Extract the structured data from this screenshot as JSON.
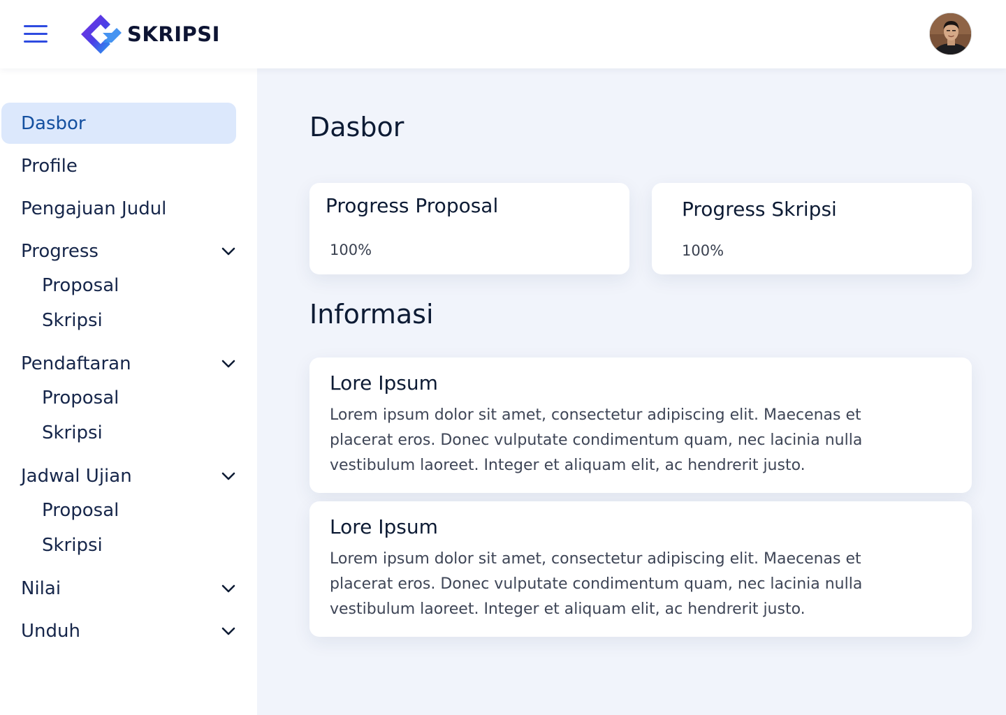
{
  "header": {
    "logo_text": "SKRIPSI",
    "menu_icon": "hamburger-menu-icon",
    "avatar_icon": "user-avatar"
  },
  "sidebar": {
    "items": [
      {
        "label": "Dasbor",
        "active": true
      },
      {
        "label": "Profile"
      },
      {
        "label": "Pengajuan Judul"
      },
      {
        "label": "Progress",
        "expandable": true,
        "children": [
          "Proposal",
          "Skripsi"
        ]
      },
      {
        "label": "Pendaftaran",
        "expandable": true,
        "children": [
          "Proposal",
          "Skripsi"
        ]
      },
      {
        "label": "Jadwal Ujian",
        "expandable": true,
        "children": [
          "Proposal",
          "Skripsi"
        ]
      },
      {
        "label": "Nilai",
        "expandable": true
      },
      {
        "label": "Unduh",
        "expandable": true
      }
    ]
  },
  "main": {
    "title": "Dasbor",
    "stats": [
      {
        "label": "Progress Proposal",
        "value": "100%"
      },
      {
        "label": "Progress Skripsi",
        "value": "100%"
      }
    ],
    "info_title": "Informasi",
    "info_cards": [
      {
        "title": "Lore Ipsum",
        "lines": [
          "Lorem ipsum dolor sit amet, consectetur adipiscing elit. Maecenas et",
          "placerat eros. Donec vulputate condimentum quam, nec lacinia nulla",
          "vestibulum laoreet. Integer et aliquam elit, ac hendrerit justo."
        ]
      },
      {
        "title": "Lore Ipsum",
        "lines": [
          "Lorem ipsum dolor sit amet, consectetur adipiscing elit. Maecenas et",
          "placerat eros. Donec vulputate condimentum quam, nec lacinia nulla",
          "vestibulum laoreet. Integer et aliquam elit, ac hendrerit justo."
        ]
      }
    ]
  },
  "colors": {
    "accent": "#2e4be0",
    "active_bg": "#dce8fc",
    "active_text": "#1450a0",
    "page_bg": "#f1f4fb"
  }
}
